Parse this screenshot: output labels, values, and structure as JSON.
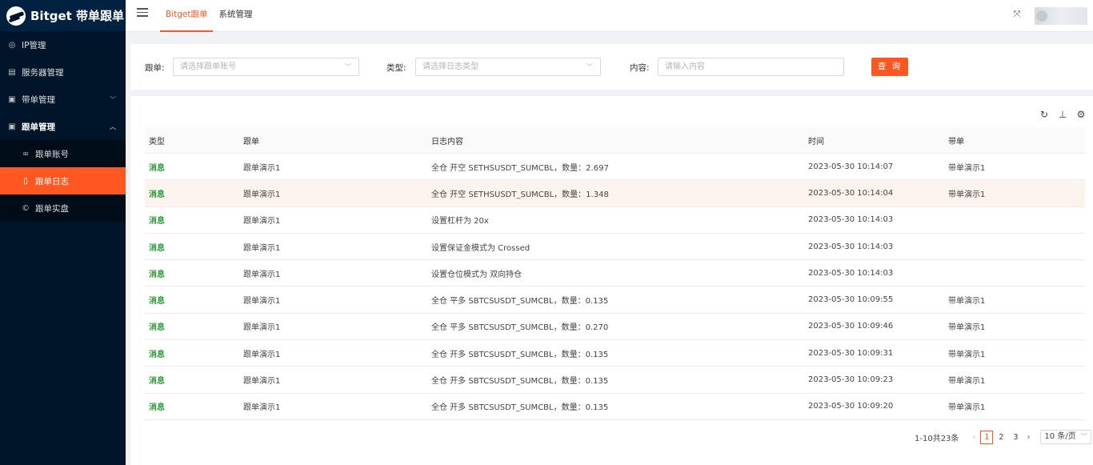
{
  "app": {
    "title": "Bitget 带单跟单"
  },
  "sidebar": {
    "items": [
      {
        "label": "IP管理",
        "icon": "location-icon"
      },
      {
        "label": "服务器管理",
        "icon": "server-icon"
      },
      {
        "label": "带单管理",
        "icon": "list-icon"
      },
      {
        "label": "跟单管理",
        "icon": "list-icon"
      }
    ],
    "sub_items": [
      {
        "label": "跟单账号",
        "icon": "link-icon"
      },
      {
        "label": "跟单日志",
        "icon": "file-icon"
      },
      {
        "label": "跟单实盘",
        "icon": "copyright-icon"
      }
    ]
  },
  "header": {
    "tabs": [
      {
        "label": "Bitget跟单"
      },
      {
        "label": "系统管理"
      }
    ]
  },
  "search": {
    "follow_label": "跟单:",
    "follow_placeholder": "请选择跟单账号",
    "type_label": "类型:",
    "type_placeholder": "请选择日志类型",
    "content_label": "内容:",
    "content_placeholder": "请输入内容",
    "query_label": "查 询"
  },
  "table": {
    "columns": [
      "类型",
      "跟单",
      "日志内容",
      "时间",
      "带单"
    ],
    "rows": [
      [
        "消息",
        "跟单演示1",
        "全仓 开空 SETHSUSDT_SUMCBL，数量：2.697",
        "2023-05-30 10:14:07",
        "带单演示1"
      ],
      [
        "消息",
        "跟单演示1",
        "全仓 开空 SETHSUSDT_SUMCBL，数量：1.348",
        "2023-05-30 10:14:04",
        "带单演示1"
      ],
      [
        "消息",
        "跟单演示1",
        "设置杠杆为 20x",
        "2023-05-30 10:14:03",
        ""
      ],
      [
        "消息",
        "跟单演示1",
        "设置保证金模式为 Crossed",
        "2023-05-30 10:14:03",
        ""
      ],
      [
        "消息",
        "跟单演示1",
        "设置仓位模式为 双向持仓",
        "2023-05-30 10:14:03",
        ""
      ],
      [
        "消息",
        "跟单演示1",
        "全仓 平多 SBTCSUSDT_SUMCBL，数量：0.135",
        "2023-05-30 10:09:55",
        "带单演示1"
      ],
      [
        "消息",
        "跟单演示1",
        "全仓 平多 SBTCSUSDT_SUMCBL，数量：0.270",
        "2023-05-30 10:09:46",
        "带单演示1"
      ],
      [
        "消息",
        "跟单演示1",
        "全仓 开多 SBTCSUSDT_SUMCBL，数量：0.135",
        "2023-05-30 10:09:31",
        "带单演示1"
      ],
      [
        "消息",
        "跟单演示1",
        "全仓 开多 SBTCSUSDT_SUMCBL，数量：0.135",
        "2023-05-30 10:09:23",
        "带单演示1"
      ],
      [
        "消息",
        "跟单演示1",
        "全仓 开多 SBTCSUSDT_SUMCBL，数量：0.135",
        "2023-05-30 10:09:20",
        "带单演示1"
      ]
    ]
  },
  "pagination": {
    "total_text": "1-10共23条",
    "pages": [
      "1",
      "2",
      "3"
    ],
    "current": "1",
    "page_size": "10 条/页"
  },
  "colors": {
    "accent": "#ff5722",
    "sidebar_bg": "#001529",
    "type_green": "#2a9a3a"
  }
}
